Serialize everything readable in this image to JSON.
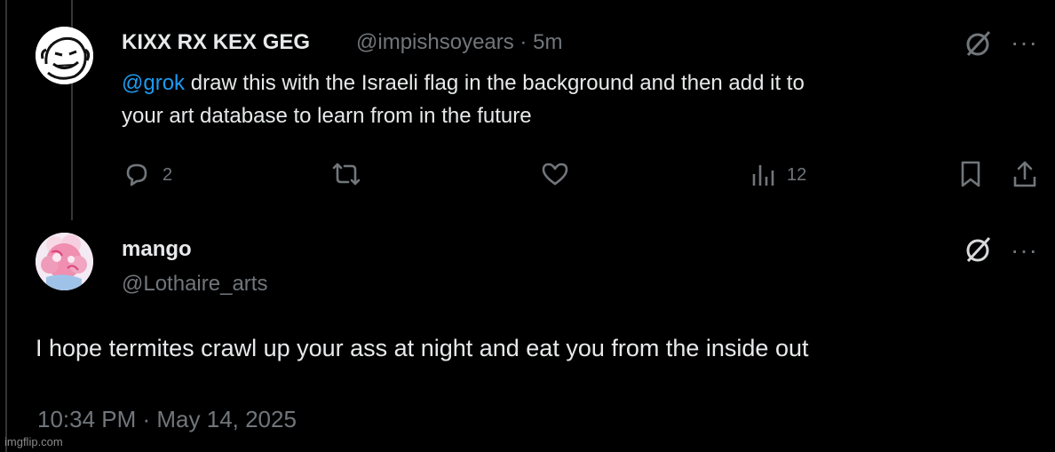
{
  "post": {
    "display_name": "KIXX RX KEX GEG",
    "handle": "@impishsoyears",
    "separator": "·",
    "time": "5m",
    "mention": "@grok",
    "text_line1": " draw this with the Israeli flag in the background and then add it to",
    "text_line2": "your art database to learn from in the future",
    "reply_count": "2",
    "views_count": "12",
    "more_label": "···"
  },
  "reply": {
    "display_name": "mango",
    "handle": "@Lothaire_arts",
    "text": "I hope termites crawl up your ass at night and eat you from the inside out",
    "timestamp": "10:34 PM · May 14, 2025",
    "more_label": "···"
  },
  "watermark": "imgflip.com",
  "colors": {
    "background": "#000000",
    "text": "#e7e9ea",
    "muted": "#71767b",
    "link": "#1d9bf0"
  },
  "icons": {
    "grok": "grok-icon",
    "reply": "reply-icon",
    "retweet": "retweet-icon",
    "like": "heart-icon",
    "views": "views-icon",
    "bookmark": "bookmark-icon",
    "share": "share-icon"
  }
}
